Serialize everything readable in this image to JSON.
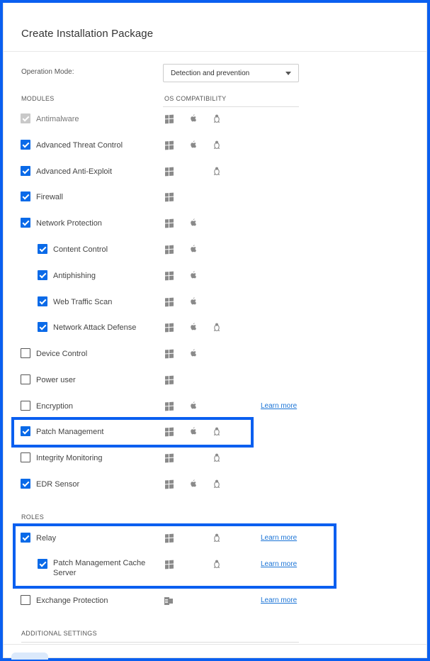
{
  "title": "Create Installation Package",
  "operation_mode": {
    "label": "Operation Mode:",
    "value": "Detection and prevention"
  },
  "headers": {
    "modules": "MODULES",
    "os_compat": "OS COMPATIBILITY",
    "roles": "ROLES",
    "additional": "ADDITIONAL SETTINGS"
  },
  "learn_more": "Learn more",
  "modules": [
    {
      "label": "Antimalware",
      "checked": true,
      "disabled": true,
      "indent": 0,
      "os": [
        "windows",
        "apple",
        "linux"
      ]
    },
    {
      "label": "Advanced Threat Control",
      "checked": true,
      "indent": 0,
      "os": [
        "windows",
        "apple",
        "linux"
      ]
    },
    {
      "label": "Advanced Anti-Exploit",
      "checked": true,
      "indent": 0,
      "os": [
        "windows",
        "linux"
      ]
    },
    {
      "label": "Firewall",
      "checked": true,
      "indent": 0,
      "os": [
        "windows"
      ]
    },
    {
      "label": "Network Protection",
      "checked": true,
      "indent": 0,
      "os": [
        "windows",
        "apple"
      ]
    },
    {
      "label": "Content Control",
      "checked": true,
      "indent": 1,
      "os": [
        "windows",
        "apple"
      ]
    },
    {
      "label": "Antiphishing",
      "checked": true,
      "indent": 1,
      "os": [
        "windows",
        "apple"
      ]
    },
    {
      "label": "Web Traffic Scan",
      "checked": true,
      "indent": 1,
      "os": [
        "windows",
        "apple"
      ]
    },
    {
      "label": "Network Attack Defense",
      "checked": true,
      "indent": 1,
      "os": [
        "windows",
        "apple",
        "linux"
      ]
    },
    {
      "label": "Device Control",
      "checked": false,
      "indent": 0,
      "os": [
        "windows",
        "apple"
      ]
    },
    {
      "label": "Power user",
      "checked": false,
      "indent": 0,
      "os": [
        "windows"
      ]
    },
    {
      "label": "Encryption",
      "checked": false,
      "indent": 0,
      "os": [
        "windows",
        "apple"
      ],
      "learn_more": true
    },
    {
      "label": "Patch Management",
      "checked": true,
      "indent": 0,
      "os": [
        "windows",
        "apple",
        "linux"
      ]
    },
    {
      "label": "Integrity Monitoring",
      "checked": false,
      "indent": 0,
      "os": [
        "windows",
        "linux"
      ]
    },
    {
      "label": "EDR Sensor",
      "checked": true,
      "indent": 0,
      "os": [
        "windows",
        "apple",
        "linux"
      ]
    }
  ],
  "roles": [
    {
      "label": "Relay",
      "checked": true,
      "indent": 0,
      "os": [
        "windows",
        "linux"
      ],
      "learn_more": true
    },
    {
      "label": "Patch Management Cache Server",
      "checked": true,
      "indent": 1,
      "os": [
        "windows",
        "linux"
      ],
      "learn_more": true
    },
    {
      "label": "Exchange Protection",
      "checked": false,
      "indent": 0,
      "os": [
        "exchange"
      ],
      "learn_more": true
    }
  ],
  "colors": {
    "accent": "#0a6ae8",
    "highlight": "#0a5ff0",
    "link": "#1b74d6"
  }
}
